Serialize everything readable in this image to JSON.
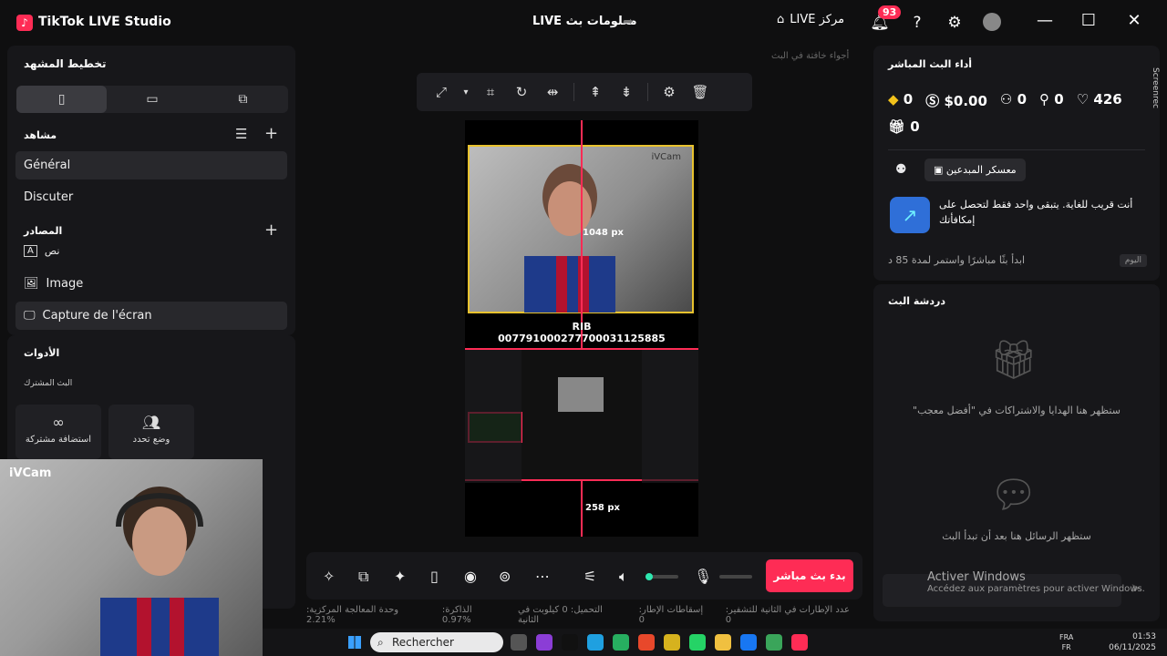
{
  "app": {
    "title": "TikTok LIVE Studio",
    "center_title": "LIVE معلومات بث",
    "live_center": "LIVE مركز",
    "notifications": "93"
  },
  "left": {
    "layout_title": "تخطيط المشهد",
    "scenes_title": "مشاهد",
    "scenes": [
      "Général",
      "Discuter"
    ],
    "sources_title": "المصادر",
    "sources": [
      "نص",
      "Image",
      "Capture de l'écran"
    ],
    "tools_title": "الأدوات",
    "co_live": "البث المشترك",
    "tool_cards": [
      "استضافة مشتركة",
      "وضع تحدد"
    ]
  },
  "canvas": {
    "top_hint": "أجواء خافتة في البث",
    "width_label": "1048 px",
    "height_label": "258 px",
    "ivcam_tag": "iVCam",
    "rib_title": "RIB",
    "rib_number": "007791000277700031125885"
  },
  "bottom": {
    "go_live": "بدء بث مباشر"
  },
  "status": [
    "وحدة المعالجة المركزية: 2.21%",
    "الذاكرة: 0.97%",
    "التحميل: 0 كيلوبت في الثانية",
    "إسقاطات الإطار: 0",
    "عدد الإطارات في الثانية للتشفير: 0"
  ],
  "right": {
    "perf_title": "أداء البث المباشر",
    "stats": {
      "diamonds": "0",
      "money": "$0.00",
      "viewers": "0",
      "followers": "0",
      "likes": "426",
      "gifts": "0"
    },
    "creator_camp": "معسكر المبدعين",
    "promo": "أنت قريب للغاية. يتبقى واحد فقط لتحصل على إمكافأتك",
    "progress": "ابدأ بثًا مباشرًا واستمر لمدة 85 د",
    "today": "اليوم",
    "chat_title": "دردشة البث",
    "chat_gifts": "\"ستظهر هنا الهدايا والاشتراكات في \"أفضل معجب",
    "chat_messages": "ستظهر الرسائل هنا بعد أن تبدأ البث",
    "activate_title": "Activer Windows",
    "activate_sub": "Accédez aux paramètres pour activer Windows."
  },
  "webcam": {
    "title": "iVCam"
  },
  "taskbar": {
    "search": "Rechercher",
    "lang_top": "FRA",
    "lang_bottom": "FR",
    "time": "01:53",
    "date": "06/11/2025"
  },
  "screenrec": "Screenrec"
}
